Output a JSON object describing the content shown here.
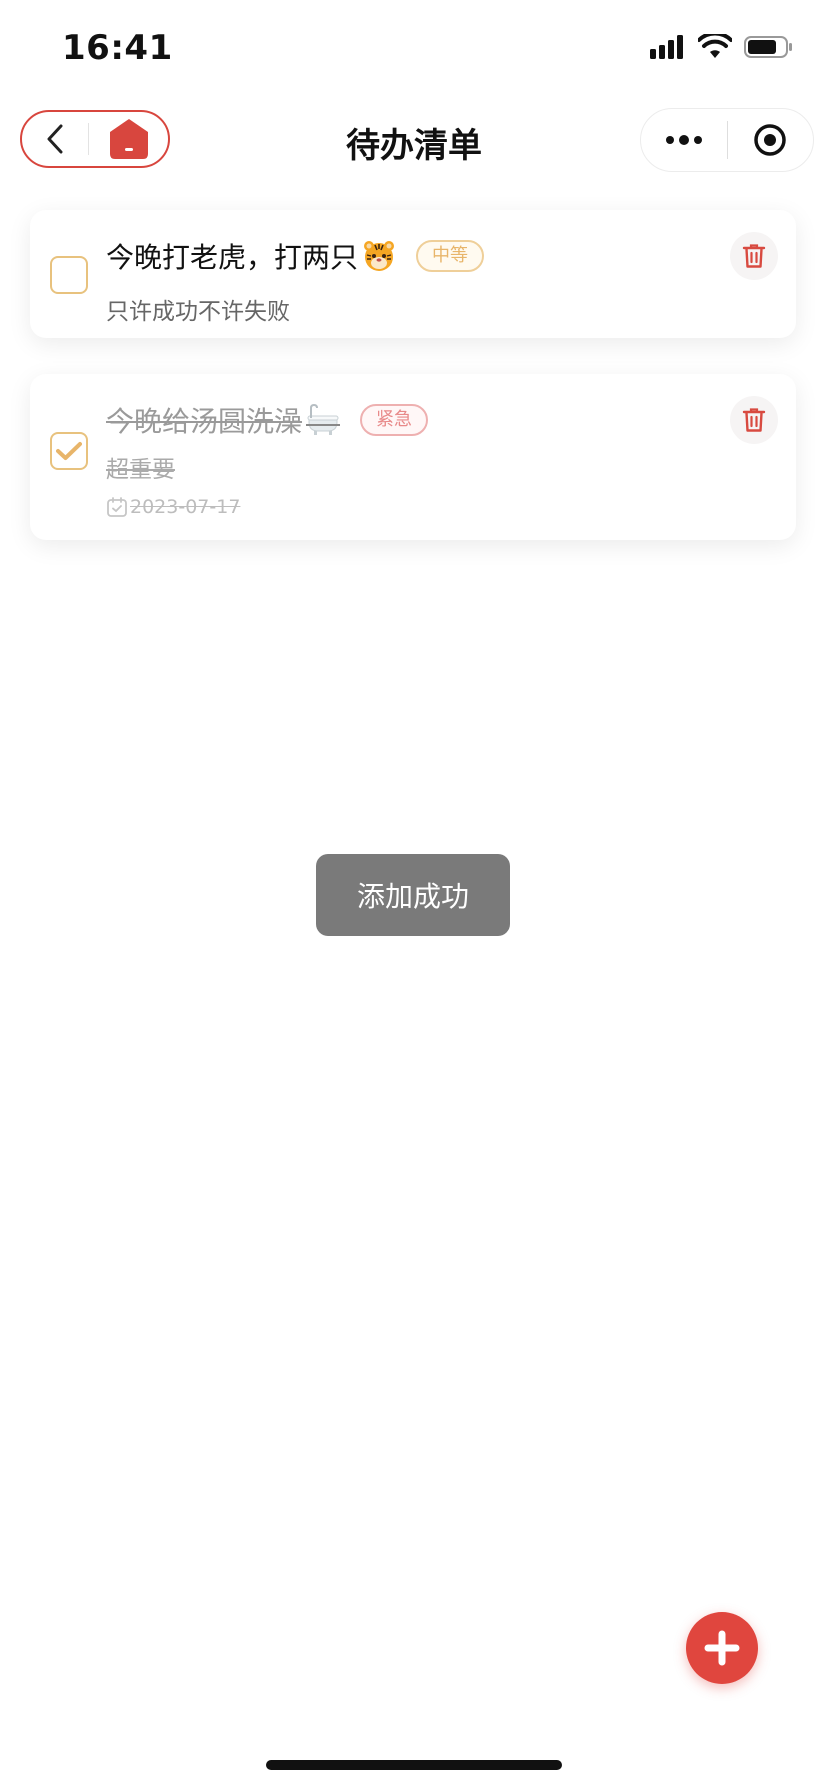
{
  "status_bar": {
    "time": "16:41",
    "icons": [
      "cellular-signal-icon",
      "wifi-icon",
      "battery-icon"
    ]
  },
  "nav": {
    "title": "待办清单",
    "left_capsule": [
      "back-icon",
      "home-icon"
    ],
    "right_capsule": [
      "more-icon",
      "target-icon"
    ],
    "accent_color": "#d8463e"
  },
  "todos": [
    {
      "title": "今晚打老虎，打两只",
      "emoji": "tiger-emoji",
      "tag": "中等",
      "description": "只许成功不许失败",
      "completed": false,
      "date": ""
    },
    {
      "title": "今晚给汤圆洗澡",
      "emoji": "bathtub-emoji",
      "tag": "紧急",
      "description": "超重要",
      "completed": true,
      "date": "2023-07-17"
    }
  ],
  "toast": {
    "message": "添加成功"
  },
  "fab": {
    "icon": "plus-icon",
    "color": "#e0463e"
  },
  "colors": {
    "tag_medium": "#e8b56a",
    "tag_urgent": "#e88a8a",
    "checkbox_border": "#e8c27e",
    "delete_icon": "#d84a40"
  }
}
